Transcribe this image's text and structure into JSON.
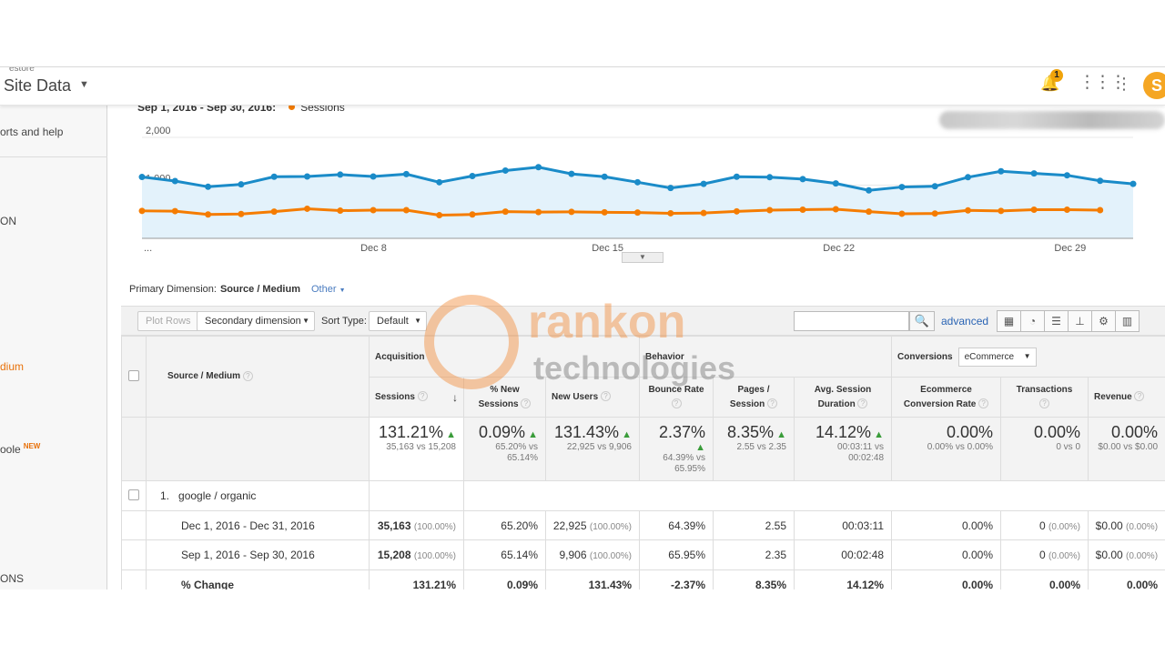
{
  "header": {
    "account_label": "estore",
    "property_title": "Site Data",
    "notification_count": "1",
    "avatar_letter": "S"
  },
  "sidebar": {
    "items": [
      "orts and help",
      "ON",
      "dium",
      "oole",
      "ONS"
    ],
    "new_badge": "NEW"
  },
  "chart": {
    "legend_range": "Sep 1, 2016 - Sep 30, 2016:",
    "legend_series": "Sessions"
  },
  "chart_data": {
    "type": "line",
    "x_tick_labels": [
      "...",
      "Dec 8",
      "Dec 15",
      "Dec 22",
      "Dec 29"
    ],
    "y_tick_labels": [
      "2,000",
      "1,000"
    ],
    "ylim": [
      0,
      2400
    ],
    "series": [
      {
        "name": "",
        "color": "#1a8bc8",
        "values": [
          1285,
          1200,
          1080,
          1130,
          1290,
          1295,
          1335,
          1295,
          1345,
          1175,
          1305,
          1420,
          1490,
          1350,
          1290,
          1175,
          1055,
          1140,
          1290,
          1280,
          1240,
          1150,
          1005,
          1075,
          1090,
          1280,
          1405,
          1360,
          1320,
          1205,
          1140
        ]
      },
      {
        "name": "Sessions",
        "color": "#f57c00",
        "values": [
          575,
          570,
          500,
          510,
          560,
          620,
          580,
          590,
          590,
          485,
          500,
          560,
          550,
          555,
          545,
          540,
          525,
          530,
          565,
          590,
          600,
          610,
          560,
          515,
          520,
          585,
          575,
          600,
          600,
          590
        ]
      }
    ],
    "grid": true
  },
  "dimension": {
    "label": "Primary Dimension:",
    "value": "Source / Medium",
    "other": "Other"
  },
  "toolbar": {
    "plot_rows": "Plot Rows",
    "secondary_dimension": "Secondary dimension",
    "sort_type_label": "Sort Type:",
    "sort_type_value": "Default",
    "advanced": "advanced"
  },
  "table": {
    "dimension_header": "Source / Medium",
    "groups": {
      "acquisition": "Acquisition",
      "behavior": "Behavior",
      "conversions": "Conversions",
      "conversions_select": "eCommerce"
    },
    "columns": [
      "Sessions",
      "% New Sessions",
      "New Users",
      "Bounce Rate",
      "Pages / Session",
      "Avg. Session Duration",
      "Ecommerce Conversion Rate",
      "Transactions",
      "Revenue"
    ],
    "totals": [
      {
        "value": "131.21%",
        "sub": "35,163 vs 15,208"
      },
      {
        "value": "0.09%",
        "sub": "65.20% vs 65.14%"
      },
      {
        "value": "131.43%",
        "sub": "22,925 vs 9,906"
      },
      {
        "value": "2.37%",
        "sub": "64.39% vs 65.95%"
      },
      {
        "value": "8.35%",
        "sub": "2.55 vs 2.35"
      },
      {
        "value": "14.12%",
        "sub": "00:03:11 vs 00:02:48"
      },
      {
        "value": "0.00%",
        "sub": "0.00% vs 0.00%"
      },
      {
        "value": "0.00%",
        "sub": "0 vs 0"
      },
      {
        "value": "0.00%",
        "sub": "$0.00 vs $0.00"
      }
    ],
    "row_index": "1.",
    "row_label": "google / organic",
    "sub_rows": [
      {
        "label": "Dec 1, 2016 - Dec 31, 2016",
        "cells": [
          [
            "35,163",
            "(100.00%)"
          ],
          [
            "65.20%",
            ""
          ],
          [
            "22,925",
            "(100.00%)"
          ],
          [
            "64.39%",
            ""
          ],
          [
            "2.55",
            ""
          ],
          [
            "00:03:11",
            ""
          ],
          [
            "0.00%",
            ""
          ],
          [
            "0",
            "(0.00%)"
          ],
          [
            "$0.00",
            "(0.00%)"
          ]
        ]
      },
      {
        "label": "Sep 1, 2016 - Sep 30, 2016",
        "cells": [
          [
            "15,208",
            "(100.00%)"
          ],
          [
            "65.14%",
            ""
          ],
          [
            "9,906",
            "(100.00%)"
          ],
          [
            "65.95%",
            ""
          ],
          [
            "2.35",
            ""
          ],
          [
            "00:02:48",
            ""
          ],
          [
            "0.00%",
            ""
          ],
          [
            "0",
            "(0.00%)"
          ],
          [
            "$0.00",
            "(0.00%)"
          ]
        ]
      }
    ],
    "change_row": {
      "label": "% Change",
      "cells": [
        "131.21%",
        "0.09%",
        "131.43%",
        "-2.37%",
        "8.35%",
        "14.12%",
        "0.00%",
        "0.00%",
        "0.00%"
      ]
    }
  },
  "watermark": {
    "line1": "rankon",
    "line2": "technologies"
  }
}
